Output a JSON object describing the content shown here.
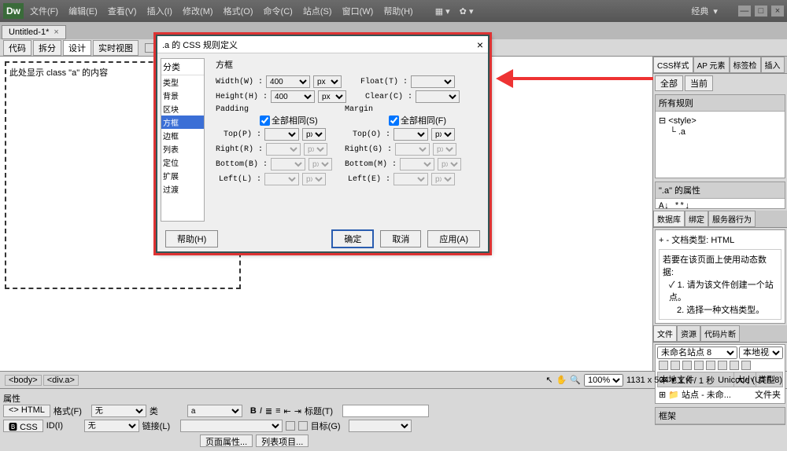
{
  "app": {
    "logo": "Dw",
    "workspace_label": "经典"
  },
  "menu": [
    "文件(F)",
    "编辑(E)",
    "查看(V)",
    "插入(I)",
    "修改(M)",
    "格式(O)",
    "命令(C)",
    "站点(S)",
    "窗口(W)",
    "帮助(H)"
  ],
  "doc": {
    "tab": "Untitled-1*",
    "views": [
      "代码",
      "拆分",
      "设计",
      "实时视图"
    ],
    "active_view": 2
  },
  "canvas_text": "此处显示 class \"a\" 的内容",
  "dialog": {
    "title": ".a 的 CSS 规则定义",
    "cat_label": "分类",
    "categories": [
      "类型",
      "背景",
      "区块",
      "方框",
      "边框",
      "列表",
      "定位",
      "扩展",
      "过渡"
    ],
    "selected_cat": 3,
    "section": "方框",
    "width_label": "Width(W) :",
    "width_val": "400",
    "width_unit": "px",
    "height_label": "Height(H) :",
    "height_val": "400",
    "height_unit": "px",
    "float_label": "Float(T) :",
    "clear_label": "Clear(C) :",
    "padding_label": "Padding",
    "margin_label": "Margin",
    "same_p": "全部相同(S)",
    "same_m": "全部相同(F)",
    "top_p": "Top(P) :",
    "right_p": "Right(R) :",
    "bottom_p": "Bottom(B) :",
    "left_p": "Left(L) :",
    "top_m": "Top(O) :",
    "right_m": "Right(G) :",
    "bottom_m": "Bottom(M) :",
    "left_m": "Left(E) :",
    "unit": "px",
    "help": "帮助(H)",
    "ok": "确定",
    "cancel": "取消",
    "apply": "应用(A)"
  },
  "status": {
    "path": [
      "<body>",
      "<div.a>"
    ],
    "zoom": "100%",
    "dims": "1131 x 504",
    "size": "1 K / 1 秒",
    "enc": "Unicode (UTF-8)"
  },
  "props": {
    "title": "属性",
    "html": "HTML",
    "css": "CSS",
    "format": "格式(F)",
    "format_val": "无",
    "id": "ID(I)",
    "id_val": "无",
    "class": "类",
    "class_val": "a",
    "link": "链接(L)",
    "title_f": "标题(T)",
    "target": "目标(G)",
    "pageprops": "页面属性...",
    "listitem": "列表项目..."
  },
  "side": {
    "css_tabs": [
      "CSS样式",
      "AP 元素",
      "标签检",
      "插入"
    ],
    "css_sub": [
      "全部",
      "当前"
    ],
    "all_rules": "所有规则",
    "rules": [
      "<style>",
      ".a"
    ],
    "props_for": "\".a\" 的属性",
    "db_tabs": [
      "数据库",
      "绑定",
      "服务器行为"
    ],
    "doctype": "文档类型: HTML",
    "dyn_hint": "若要在该页面上使用动态数据:",
    "dyn1": "1. 请为该文件创建一个站点。",
    "dyn2": "2. 选择一种文档类型。",
    "files_tabs": [
      "文件",
      "资源",
      "代码片断"
    ],
    "site": "未命名站点 8",
    "view": "本地视图",
    "cols": [
      "本地文件",
      "大小",
      "类型"
    ],
    "row": "站点 - 未命...",
    "row_type": "文件夹",
    "frame": "框架"
  }
}
